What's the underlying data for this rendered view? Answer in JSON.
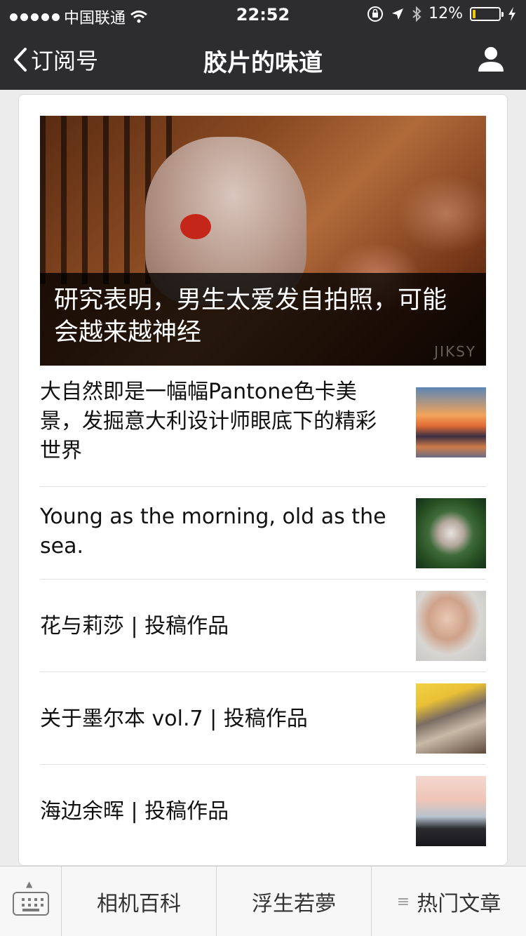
{
  "status_bar": {
    "carrier": "中国联通",
    "time": "22:52",
    "battery_percent": "12%",
    "battery_level": 0.12,
    "battery_color": "#f4c90c"
  },
  "nav": {
    "back_label": "订阅号",
    "title": "胶片的味道"
  },
  "hero": {
    "caption": "研究表明，男生太爱发自拍照，可能会越来越神经",
    "watermark": "JIKSY"
  },
  "articles": [
    {
      "title": "大自然即是一幅幅Pantone色卡美景，发掘意大利设计师眼底下的精彩世界"
    },
    {
      "title": "Young as the morning, old as the sea."
    },
    {
      "title": "花与莉莎 | 投稿作品"
    },
    {
      "title": "关于墨尔本 vol.7 | 投稿作品"
    },
    {
      "title": "海边余晖 | 投稿作品"
    }
  ],
  "bottom_menu": {
    "items": [
      "相机百科",
      "浮生若夢",
      "热门文章"
    ],
    "menu_icon": "≡"
  },
  "colors": {
    "nav_background": "#2d2d2f",
    "page_background": "#ececec"
  }
}
